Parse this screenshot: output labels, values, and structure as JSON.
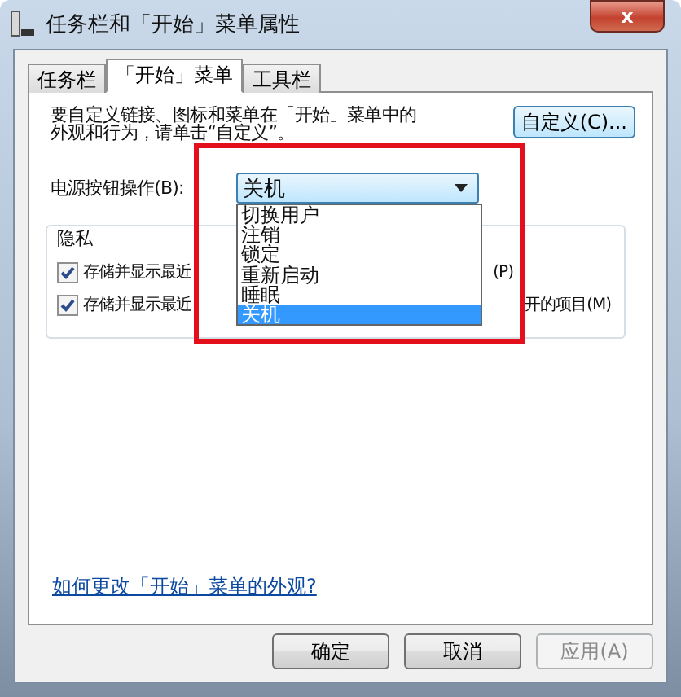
{
  "window": {
    "title": "任务栏和「开始」菜单属性",
    "close": "x"
  },
  "tabs": [
    {
      "label": "任务栏",
      "selected": false
    },
    {
      "label": "「开始」菜单",
      "selected": true
    },
    {
      "label": "工具栏",
      "selected": false
    }
  ],
  "description": {
    "line_1": "要自定义链接、图标和菜单在「开始」菜单中的",
    "line_2": "外观和行为，请单击“自定义”。"
  },
  "customize_button": "自定义(C)...",
  "power_button": {
    "label": "电源按钮操作(B):",
    "value": "关机",
    "expanded": true,
    "options": [
      {
        "label": "切换用户",
        "selected": false
      },
      {
        "label": "注销",
        "selected": false
      },
      {
        "label": "锁定",
        "selected": false
      },
      {
        "label": "重新启动",
        "selected": false
      },
      {
        "label": "睡眠",
        "selected": false
      },
      {
        "label": "关机",
        "selected": true
      }
    ]
  },
  "privacy": {
    "title": "隐私",
    "items": [
      {
        "label_start": "存储并显示最近",
        "label_end": "(P)",
        "checked": true
      },
      {
        "label_start": "存储并显示最近",
        "label_end": "开的项目(M)",
        "checked": true
      }
    ]
  },
  "help_link": "如何更改「开始」菜单的外观?",
  "buttons": [
    {
      "label": "确定",
      "disabled": false
    },
    {
      "label": "取消",
      "disabled": false
    },
    {
      "label": "应用(A)",
      "disabled": true
    }
  ]
}
